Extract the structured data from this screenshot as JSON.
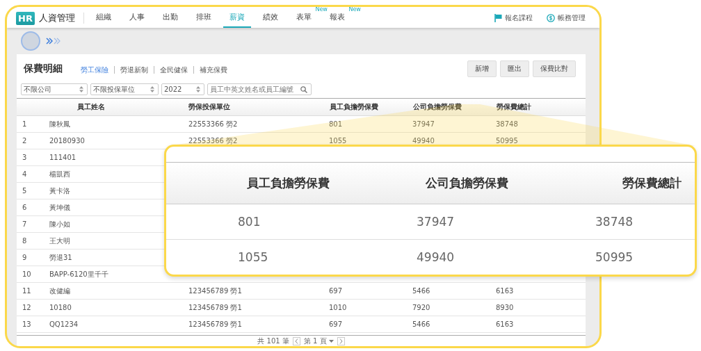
{
  "app": {
    "logo": "HR",
    "title": "人資管理"
  },
  "nav_tabs": [
    {
      "label": "組織",
      "selected": false
    },
    {
      "label": "人事",
      "selected": false
    },
    {
      "label": "出勤",
      "selected": false
    },
    {
      "label": "排班",
      "selected": false
    },
    {
      "label": "薪資",
      "selected": true
    },
    {
      "label": "績效",
      "selected": false
    },
    {
      "label": "表單",
      "selected": false,
      "badge": "New"
    },
    {
      "label": "報表",
      "selected": false,
      "badge": "New"
    }
  ],
  "header_links": [
    {
      "kind": "flag",
      "label": "報名課程"
    },
    {
      "kind": "dollar",
      "label": "帳務管理"
    }
  ],
  "page": {
    "title": "保費明細",
    "sub_tabs": [
      {
        "label": "勞工保險",
        "selected": true
      },
      {
        "label": "勞退新制",
        "selected": false
      },
      {
        "label": "全民健保",
        "selected": false
      },
      {
        "label": "補充保費",
        "selected": false
      }
    ],
    "buttons": [
      "新增",
      "匯出",
      "保費比對"
    ],
    "filters": [
      {
        "kind": "select",
        "value": "不限公司"
      },
      {
        "kind": "select",
        "value": "不限投保單位"
      },
      {
        "kind": "select",
        "value": "2022"
      },
      {
        "kind": "search",
        "placeholder": "員工中英文姓名或員工編號"
      }
    ]
  },
  "table": {
    "columns": [
      "員工姓名",
      "勞保投保單位",
      "員工負擔勞保費",
      "公司負擔勞保費",
      "勞保費總計"
    ],
    "rows": [
      {
        "no": "1",
        "name": "陳秋鳳",
        "unit": "22553366 勞2",
        "employee_fee": "801",
        "company_fee": "37947",
        "total": "38748"
      },
      {
        "no": "2",
        "name": "20180930",
        "unit": "22553366 勞2",
        "employee_fee": "1055",
        "company_fee": "49940",
        "total": "50995"
      },
      {
        "no": "3",
        "name": "111401"
      },
      {
        "no": "4",
        "name": "楊凱西"
      },
      {
        "no": "5",
        "name": "黃卡洛"
      },
      {
        "no": "6",
        "name": "黃坤儀"
      },
      {
        "no": "7",
        "name": "陳小如"
      },
      {
        "no": "8",
        "name": "王大明"
      },
      {
        "no": "9",
        "name": "勞退31"
      },
      {
        "no": "10",
        "name": "BAPP-6120里千千"
      },
      {
        "no": "11",
        "name": "改健編",
        "unit": "123456789 勞1",
        "employee_fee": "697",
        "company_fee": "5466",
        "total": "6163"
      },
      {
        "no": "12",
        "name": "10180",
        "unit": "123456789 勞1",
        "employee_fee": "1010",
        "company_fee": "7920",
        "total": "8930"
      },
      {
        "no": "13",
        "name": "QQ1234",
        "unit": "123456789 勞1",
        "employee_fee": "697",
        "company_fee": "5466",
        "total": "6163"
      }
    ]
  },
  "pager": {
    "total": "共 101 筆",
    "page": "第 1 頁"
  },
  "callout": {
    "columns": [
      "員工負擔勞保費",
      "公司負擔勞保費",
      "勞保費總計"
    ],
    "rows": [
      {
        "employee_fee": "801",
        "company_fee": "37947",
        "total": "38748"
      },
      {
        "employee_fee": "1055",
        "company_fee": "49940",
        "total": "50995"
      }
    ]
  }
}
